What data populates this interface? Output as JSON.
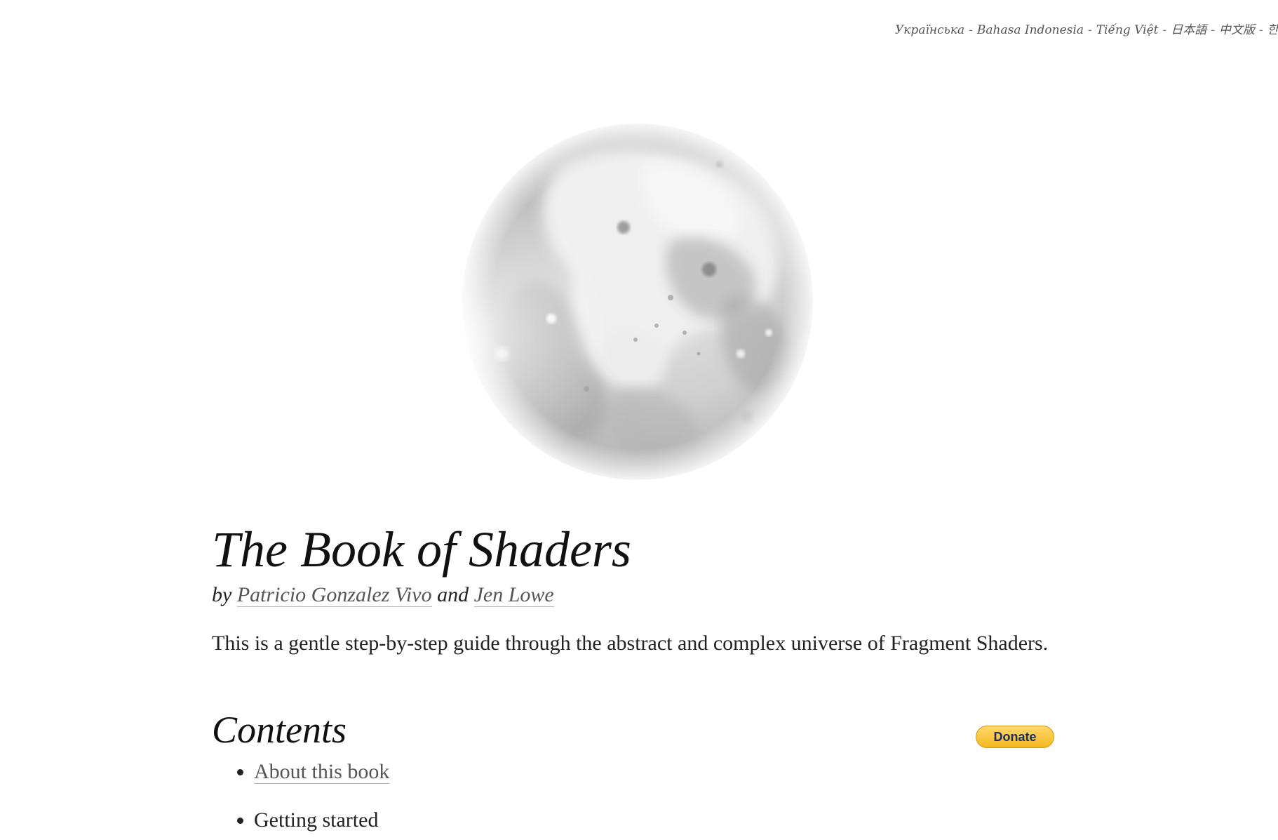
{
  "languages": [
    {
      "label": "Українська"
    },
    {
      "label": "Bahasa Indonesia"
    },
    {
      "label": "Tiếng Việt"
    },
    {
      "label": "日本語"
    },
    {
      "label": "中文版"
    },
    {
      "label": "한국어"
    }
  ],
  "language_separator": "-",
  "hero": {
    "image": "moon-image"
  },
  "book": {
    "title": "The Book of Shaders",
    "byline_prefix": "by",
    "author1": "Patricio Gonzalez Vivo",
    "byline_and": "and",
    "author2": "Jen Lowe",
    "intro": "This is a gentle step-by-step guide through the abstract and complex universe of Fragment Shaders."
  },
  "contents": {
    "title": "Contents",
    "donate_label": "Donate",
    "items": [
      {
        "label": "About this book",
        "is_link": true
      },
      {
        "label": "Getting started",
        "is_link": false
      }
    ]
  },
  "colors": {
    "background": "#ffffff",
    "link": "#555555",
    "donate": "#f5b81f"
  }
}
